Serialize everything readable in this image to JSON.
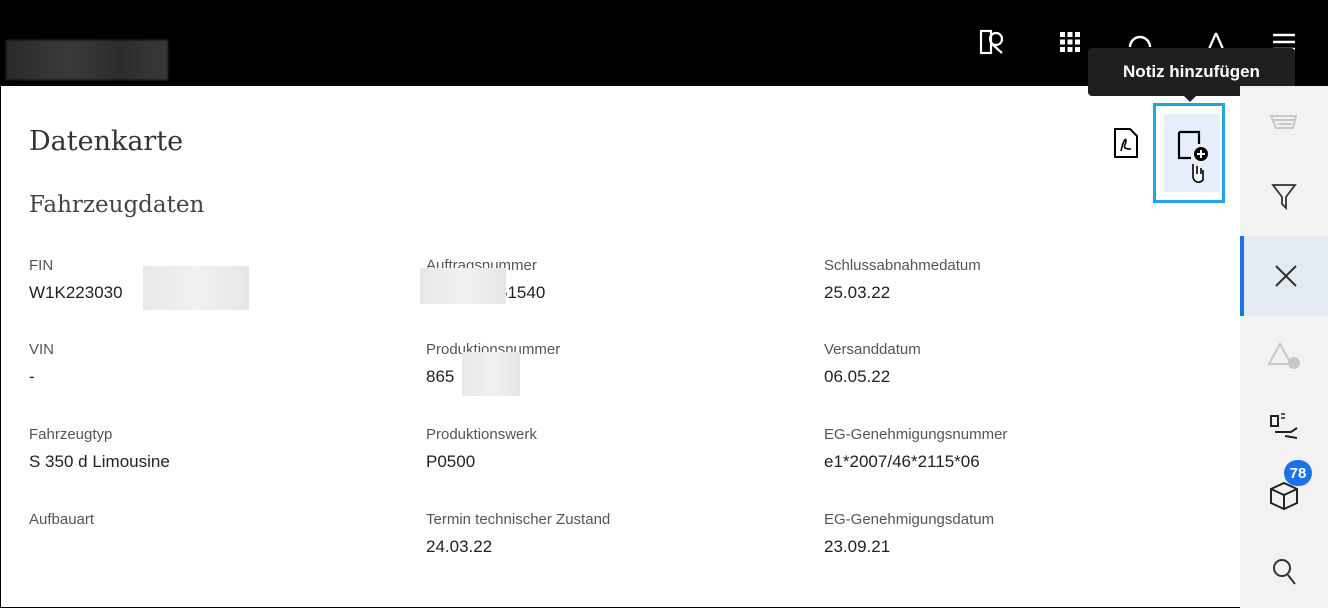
{
  "header": {
    "icons": [
      "vin-scan-icon",
      "apps-grid-icon",
      "headset-icon",
      "warning-icon",
      "menu-icon"
    ]
  },
  "tooltip": {
    "text": "Notiz hinzufügen"
  },
  "page": {
    "title": "Datenkarte",
    "section": "Fahrzeugdaten"
  },
  "fields": [
    {
      "label": "FIN",
      "value": "W1K223030"
    },
    {
      "label": "Auftragsnummer",
      "value": "61540"
    },
    {
      "label": "Schlussabnahmedatum",
      "value": "25.03.22"
    },
    {
      "label": "VIN",
      "value": "-"
    },
    {
      "label": "Produktionsnummer",
      "value": "865"
    },
    {
      "label": "Versanddatum",
      "value": "06.05.22"
    },
    {
      "label": "Fahrzeugtyp",
      "value": "S 350 d Limousine"
    },
    {
      "label": "Produktionswerk",
      "value": "P0500"
    },
    {
      "label": "EG-Genehmigungsnummer",
      "value": "e1*2007/46*2115*06"
    },
    {
      "label": "Aufbauart",
      "value": ""
    },
    {
      "label": "Termin technischer Zustand",
      "value": "24.03.22"
    },
    {
      "label": "EG-Genehmigungsdatum",
      "value": "23.09.21"
    }
  ],
  "rail": {
    "badge_count": "78",
    "items": [
      "cart-icon",
      "filter-icon",
      "close-icon",
      "warning-info-icon",
      "oil-service-icon",
      "package-icon",
      "search-icon"
    ]
  },
  "colors": {
    "accent": "#1a73e8",
    "highlight_border": "#1fa6e0",
    "topbar": "#000000"
  }
}
